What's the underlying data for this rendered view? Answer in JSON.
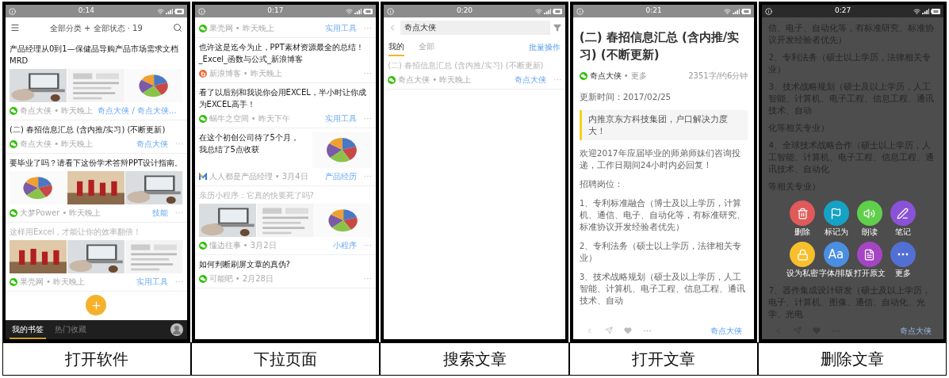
{
  "panels": [
    {
      "kind": "list",
      "status_bar": {
        "time": "0:14"
      },
      "header": {
        "title": "全部分类 + 全部状态 · 19"
      },
      "articles": [
        {
          "kind": "gallery",
          "title": "产品经理从0到1—保健品导购产品市场需求文档MRD",
          "read": false,
          "source": {
            "kind": "wechat",
            "meta": "奇点大侠 • 昨天晚上"
          },
          "tag": "奇点大侠 / 奇点大侠..."
        },
        {
          "kind": "text",
          "title": "(二) 春招信息汇总 (含内推/实习) (不断更新)",
          "read": false,
          "source": {
            "kind": "wechat",
            "meta": "奇点大侠 • 昨天晚上"
          },
          "tag": "奇点大侠"
        },
        {
          "kind": "gallery",
          "title": "要毕业了吗？请看下这份学术答辩PPT设计指南。",
          "read": false,
          "source": {
            "kind": "wechat",
            "meta": "大梦Power • 昨天晚上"
          },
          "tag": "技能"
        },
        {
          "kind": "gallery",
          "title": "这样用Excel，才能让你的效率翻倍！",
          "read": true,
          "source": {
            "kind": "wechat",
            "meta": "果壳网 • 昨天晚上"
          },
          "tag": "实用工具"
        }
      ],
      "bottom_tabs": [
        {
          "label": "我的书签",
          "selected": true
        },
        {
          "label": "热门收藏",
          "selected": false
        }
      ]
    },
    {
      "kind": "list",
      "status_bar": {
        "time": "0:17"
      },
      "articles": [
        {
          "kind": "text",
          "source": {
            "kind": "wechat",
            "meta": "果壳网 • 昨天晚上"
          },
          "tag": "实用工具"
        },
        {
          "kind": "text",
          "title": "也许这是迄今为止，PPT素材资源最全的总结！_Excel_函数与公式_新浪博客",
          "read": false,
          "source": {
            "kind": "blog",
            "meta": "新浪博客 • 昨天晚上"
          }
        },
        {
          "kind": "text",
          "title": "看了以后别和我说你会用EXCEL，半小时让你成为EXCEL高手！",
          "read": false,
          "source": {
            "kind": "wechat",
            "meta": "蜗牛之空间 • 昨天下午"
          },
          "tag": "实用工具"
        },
        {
          "kind": "thumbnail",
          "title": "在这个初创公司待了5个月，我总结了5点收获",
          "read": false,
          "source": {
            "kind": "m-logo",
            "meta": "人人都是产品经理 • 3月4日"
          },
          "tag": "产品经历"
        },
        {
          "kind": "gallery",
          "title": "亲历小程序：它真的快要死了吗?",
          "read": true,
          "source": {
            "kind": "wechat",
            "meta": "懂边往事 • 3月2日"
          },
          "tag": "小程序"
        },
        {
          "kind": "text",
          "title": "如何判断刷屏文章的真伪?",
          "read": false,
          "source": {
            "kind": "wechat",
            "meta": "可能吧 • 2月28日"
          }
        }
      ]
    },
    {
      "kind": "search",
      "status_bar": {
        "time": "0:20"
      },
      "search": {
        "value": "奇点大侠"
      },
      "tabs": [
        {
          "label": "我的",
          "selected": true
        },
        {
          "label": "全部",
          "selected": false
        }
      ],
      "batch_link": "批量操作",
      "articles": [
        {
          "kind": "text",
          "title": "(二) 春招信息汇总 (含内推/实习) (不断更新)",
          "read": true,
          "source": {
            "kind": "wechat",
            "meta": "奇点大侠 • 昨天晚上"
          },
          "tag": "奇点大侠"
        }
      ]
    },
    {
      "kind": "article",
      "status_bar": {
        "time": "0:21"
      },
      "title": "(二) 春招信息汇总 (含内推/实习) (不断更新)",
      "author": "奇点大侠",
      "more": "• 更多",
      "stats": "2351字/约6分钟",
      "paragraphs": [
        {
          "kind": "text",
          "text": "更新时间：2017/02/25"
        },
        {
          "kind": "quote",
          "text": "内推京东方科技集团，户口解决力度大！"
        },
        {
          "kind": "text",
          "text": "欢迎2017年应届毕业的师弟师妹们咨询投递，工作日期间24小时内必回复！"
        },
        {
          "kind": "text",
          "text": "招聘岗位："
        },
        {
          "kind": "text",
          "text": "1、专利标准融合（博士及以上学历，计算机、通信、电子、自动化等，有标准研究、标准协议开发经验者优先）"
        },
        {
          "kind": "text",
          "text": "2、专利法务（硕士以上学历，法律相关专业）"
        },
        {
          "kind": "text",
          "text": "3、技术战略规划（硕士及以上学历，人工智能、计算机、电子工程、信息工程、通讯技术、自动"
        }
      ],
      "toolbar": {
        "author": "奇点大侠"
      }
    },
    {
      "kind": "article-menu",
      "status_bar": {
        "time": "0:27"
      },
      "paragraphs": [
        {
          "kind": "text",
          "text": "信、电子、自动化等，有标准研究、标准协议开发经验者优先）"
        },
        {
          "kind": "text",
          "text": "2、专利法务（硕士以上学历，法律相关专业）"
        },
        {
          "kind": "text",
          "text": "3、技术战略规划（硕士及以上学历，人工智能、计算机、电子工程、信息工程、通讯技术、自动"
        },
        {
          "kind": "text",
          "text": "化等相关专业）"
        },
        {
          "kind": "text",
          "text": "4、全球技术战略合作（硕士以上学历，人工智能、计算机、电子工程、信息工程、通讯技术、自动化"
        },
        {
          "kind": "text",
          "text": "等相关专业）"
        }
      ],
      "actions": [
        {
          "kind": "trash",
          "label": "删除",
          "color": "#e05a5a"
        },
        {
          "kind": "flag",
          "label": "标记为",
          "color": "#16a2c4"
        },
        {
          "kind": "speaker",
          "label": "朗读",
          "color": "#5fcf4c"
        },
        {
          "kind": "pen",
          "label": "笔记",
          "color": "#8a52d6"
        },
        {
          "kind": "lock",
          "label": "设为私密",
          "color": "#f7bf2c"
        },
        {
          "kind": "font",
          "glyph": "Aa",
          "label": "字体/排版",
          "color": "#4a8fe2"
        },
        {
          "kind": "document",
          "label": "打开原文",
          "color": "#a545c4"
        },
        {
          "kind": "more",
          "label": "更多",
          "color": "#5270d4"
        }
      ],
      "after_text": "7、器件集成设计研发（硕士及以上学历，电子、计算机、图像、通信、自动化、光学、光电",
      "toolbar": {
        "author": "奇点大侠"
      }
    }
  ],
  "captions": [
    "打开软件",
    "下拉页面",
    "搜索文章",
    "打开文章",
    "删除文章"
  ]
}
